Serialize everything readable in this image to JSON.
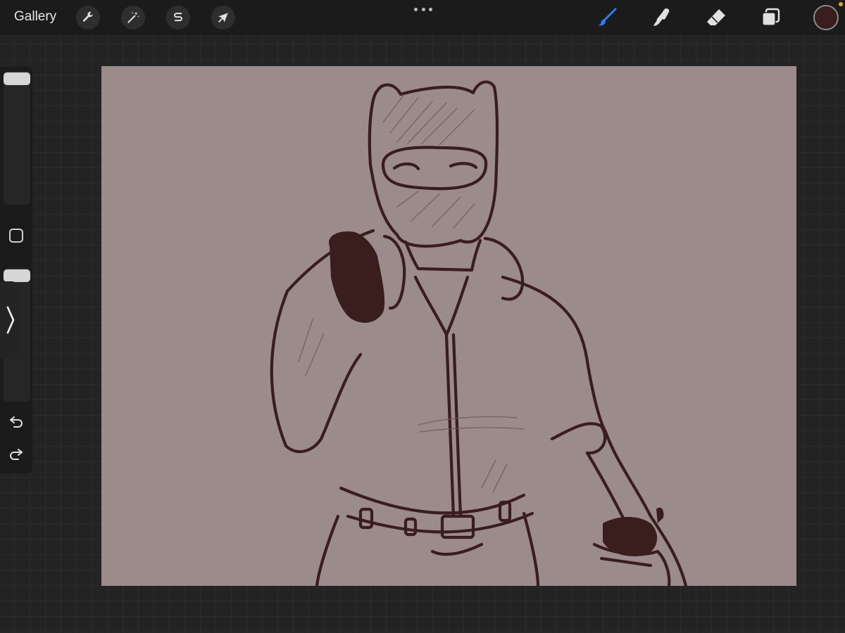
{
  "topbar": {
    "gallery_label": "Gallery",
    "actions": [
      {
        "name": "actions-wrench-icon"
      },
      {
        "name": "adjustments-magic-wand-icon"
      },
      {
        "name": "selection-s-icon"
      },
      {
        "name": "transform-arrow-icon"
      }
    ],
    "right_tools": [
      {
        "name": "brush-icon",
        "active": true
      },
      {
        "name": "smudge-icon",
        "active": false
      },
      {
        "name": "eraser-icon",
        "active": false
      },
      {
        "name": "layers-icon",
        "active": false
      }
    ],
    "active_color": "#3a1d1d"
  },
  "canvas": {
    "background_color": "#9c8b8b",
    "line_color": "#3a1d1d",
    "subject": "sketch"
  },
  "colors": {
    "toolbar_bg": "#1b1b1b",
    "workspace_bg": "#232323",
    "accent_brush": "#2f7cf6",
    "notification": "#f0a020"
  }
}
